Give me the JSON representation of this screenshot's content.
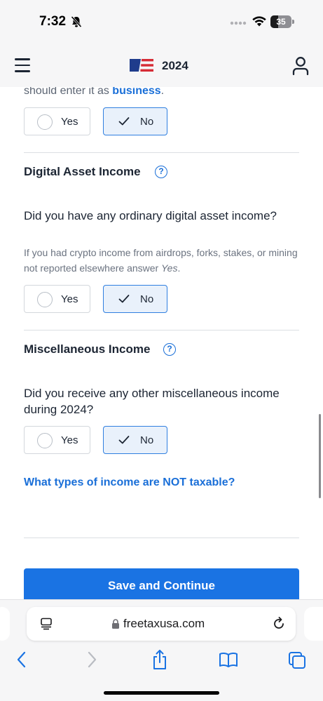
{
  "status": {
    "time": "7:32",
    "battery": "35"
  },
  "header": {
    "year": "2024"
  },
  "intro": {
    "prefix": "should enter it as ",
    "link": "business",
    "suffix": "."
  },
  "options": {
    "yes": "Yes",
    "no": "No"
  },
  "sections": {
    "digital": {
      "title": "Digital Asset Income",
      "question": "Did you have any ordinary digital asset income?",
      "hint_prefix": "If you had crypto income from airdrops, forks, stakes, or mining not reported elsewhere answer ",
      "hint_em": "Yes",
      "hint_suffix": "."
    },
    "misc": {
      "title": "Miscellaneous Income",
      "question": "Did you receive any other miscellaneous income during 2024?"
    }
  },
  "link_nontaxable": "What types of income are NOT taxable?",
  "save_button": "Save and Continue",
  "browser": {
    "url": "freetaxusa.com"
  },
  "colors": {
    "accent": "#1a73e3",
    "link": "#1a6fd8",
    "selected_bg": "#e9f1fb"
  },
  "icons": [
    "bell-slash-icon",
    "wifi-icon",
    "menu-icon",
    "flag-logo-icon",
    "user-icon",
    "check-icon",
    "help-icon",
    "reader-icon",
    "lock-icon",
    "reload-icon",
    "back-icon",
    "forward-icon",
    "share-icon",
    "bookmarks-icon",
    "tabs-icon"
  ]
}
